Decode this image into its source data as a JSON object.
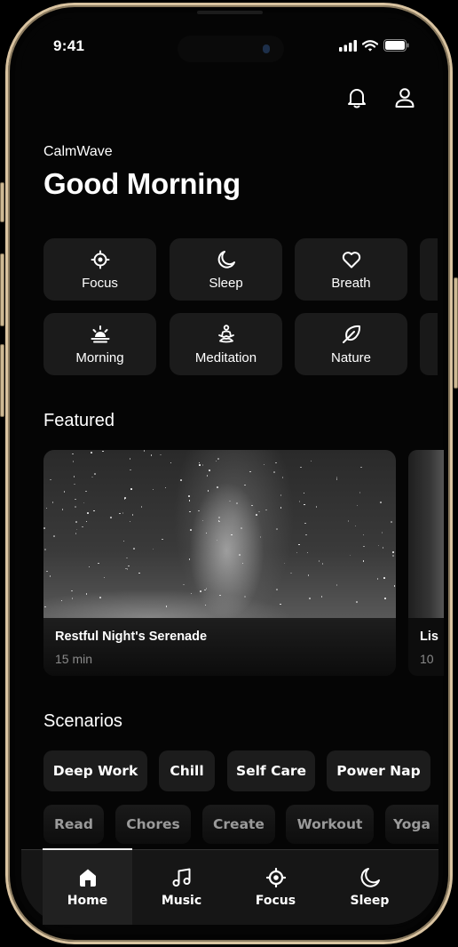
{
  "status_bar": {
    "time": "9:41"
  },
  "header": {
    "brand": "CalmWave",
    "greeting": "Good Morning",
    "actions": [
      {
        "icon": "bell-icon"
      },
      {
        "icon": "user-icon"
      }
    ]
  },
  "categories": [
    {
      "label": "Focus",
      "icon": "target-icon"
    },
    {
      "label": "Sleep",
      "icon": "moon-icon"
    },
    {
      "label": "Breath",
      "icon": "heart-icon"
    },
    {
      "label": "Morning",
      "icon": "sunrise-icon"
    },
    {
      "label": "Meditation",
      "icon": "meditation-icon"
    },
    {
      "label": "Nature",
      "icon": "leaf-icon"
    }
  ],
  "featured": {
    "title": "Featured",
    "cards": [
      {
        "title": "Restful Night's Serenade",
        "duration": "15 min"
      },
      {
        "title": "Lis",
        "duration": "10"
      }
    ]
  },
  "scenarios": {
    "title": "Scenarios",
    "row1": [
      "Deep Work",
      "Chill",
      "Self Care",
      "Power Nap"
    ],
    "row2": [
      "Read",
      "Chores",
      "Create",
      "Workout",
      "Yoga"
    ]
  },
  "tabbar": {
    "active": "Home",
    "tabs": [
      {
        "label": "Home",
        "icon": "home-icon"
      },
      {
        "label": "Music",
        "icon": "music-icon"
      },
      {
        "label": "Focus",
        "icon": "target-icon"
      },
      {
        "label": "Sleep",
        "icon": "moon-icon"
      }
    ]
  },
  "colors": {
    "background": "#050505",
    "surface": "#1b1b1b",
    "frame": "#d9c3a0",
    "text": "#ffffff",
    "muted": "#8a8a8a"
  }
}
